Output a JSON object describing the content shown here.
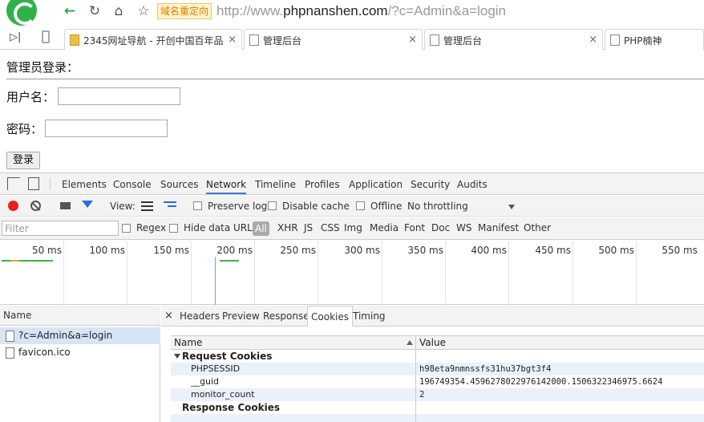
{
  "browser": {
    "redirect_badge": "域名重定向",
    "url_prefix": "http://www.",
    "url_host": "phpnanshen.com",
    "url_path": "/?c=Admin&a=login"
  },
  "tabs": [
    {
      "title": "2345网址导航 - 开创中国百年品",
      "close": "×"
    },
    {
      "title": "管理后台",
      "close": "×"
    },
    {
      "title": "管理后台",
      "close": "×"
    },
    {
      "title": "PHP楠神",
      "close": ""
    }
  ],
  "page": {
    "heading": "管理员登录：",
    "username_label": "用户名：",
    "password_label": "密码：",
    "login_button": "登录"
  },
  "devtools": {
    "tabs": [
      "Elements",
      "Console",
      "Sources",
      "Network",
      "Timeline",
      "Profiles",
      "Application",
      "Security",
      "Audits"
    ],
    "active_tab": "Network",
    "toolbar": {
      "view_label": "View:",
      "preserve_log": "Preserve log",
      "disable_cache": "Disable cache",
      "offline": "Offline",
      "throttling": "No throttling"
    },
    "filter": {
      "placeholder": "Filter",
      "regex": "Regex",
      "hide_data_urls": "Hide data URLs",
      "all": "All",
      "types": [
        "XHR",
        "JS",
        "CSS",
        "Img",
        "Media",
        "Font",
        "Doc",
        "WS",
        "Manifest",
        "Other"
      ]
    },
    "overview_ticks": [
      "50 ms",
      "100 ms",
      "150 ms",
      "200 ms",
      "250 ms",
      "300 ms",
      "350 ms",
      "400 ms",
      "450 ms",
      "500 ms",
      "550 ms"
    ],
    "requests": {
      "header": "Name",
      "items": [
        "?c=Admin&a=login",
        "favicon.ico"
      ]
    },
    "detail": {
      "close": "×",
      "tabs": [
        "Headers",
        "Preview",
        "Response",
        "Cookies",
        "Timing"
      ],
      "active_tab": "Cookies",
      "columns": {
        "name": "Name",
        "value": "Value"
      },
      "request_cookies_label": "Request Cookies",
      "request_cookies": [
        {
          "name": "PHPSESSID",
          "value": "h98eta9nmnssfs31hu37bgt3f4"
        },
        {
          "name": "__guid",
          "value": "196749354.4596278022976142000.1506322346975.6624"
        },
        {
          "name": "monitor_count",
          "value": "2"
        }
      ],
      "response_cookies_label": "Response Cookies"
    }
  },
  "colors": {
    "accent": "#3879d9",
    "record": "#e62020",
    "selected_row": "#d6e4f5"
  }
}
